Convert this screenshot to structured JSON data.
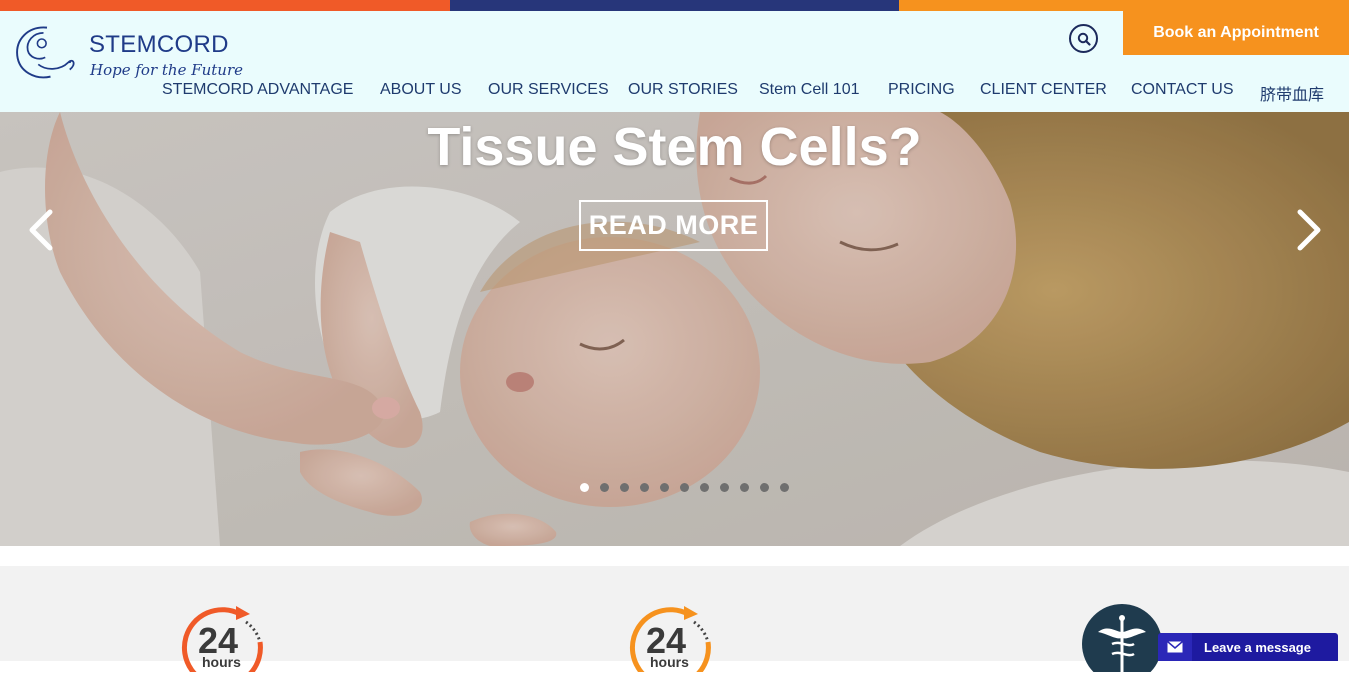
{
  "topbar": {
    "colors": [
      "#f05a28",
      "#27367a",
      "#f6921e"
    ]
  },
  "brand": {
    "name": "STEMCORD",
    "tagline": "Hope for the Future",
    "logo_icon": "mother-baby-logo-icon"
  },
  "header": {
    "search_icon": "search-icon",
    "book_label": "Book an Appointment"
  },
  "nav": {
    "items": [
      {
        "label": "STEMCORD ADVANTAGE"
      },
      {
        "label": "ABOUT US"
      },
      {
        "label": "OUR SERVICES"
      },
      {
        "label": "OUR STORIES"
      },
      {
        "label": "Stem Cell 101"
      },
      {
        "label": "PRICING"
      },
      {
        "label": "CLIENT CENTER"
      },
      {
        "label": "CONTACT US"
      },
      {
        "label": "脐带血库"
      }
    ]
  },
  "hero": {
    "title": "Tissue Stem Cells?",
    "cta": "READ MORE",
    "prev_icon": "chevron-left-icon",
    "next_icon": "chevron-right-icon",
    "slides_total": 11,
    "active_slide": 1
  },
  "features": [
    {
      "icon": "24-hours-clock-icon",
      "number": "24",
      "unit": "hours",
      "accent": "#f05a28"
    },
    {
      "icon": "24-hours-clock-icon",
      "number": "24",
      "unit": "hours",
      "accent": "#f6921e"
    },
    {
      "icon": "caduceus-medical-icon",
      "accent": "#1f3b4e"
    }
  ],
  "chat": {
    "label": "Leave a message",
    "icon": "envelope-icon"
  },
  "colors": {
    "brand_blue": "#1f3b88",
    "accent_orange": "#f6921e",
    "header_bg": "#eafcfd",
    "chat_bg": "#1e1aa0"
  }
}
